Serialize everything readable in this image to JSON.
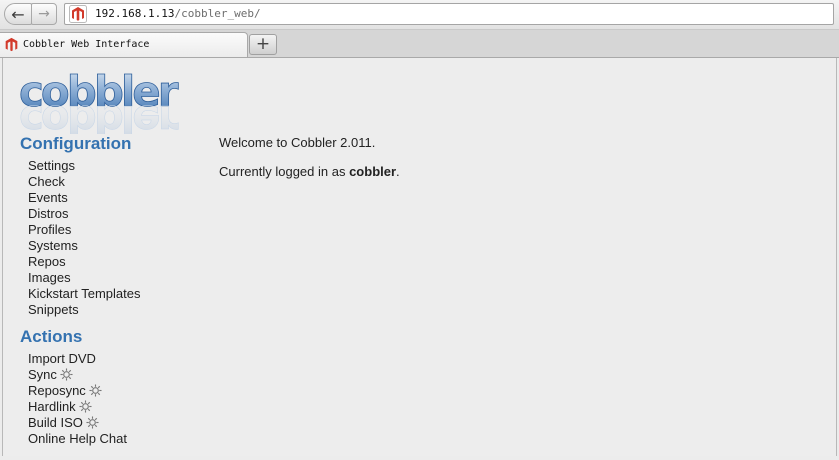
{
  "browser": {
    "url_host": "192.168.1.13",
    "url_path": "/cobbler_web/",
    "tab_title": "Cobbler Web Interface",
    "new_tab_symbol": "+",
    "back_symbol": "←",
    "forward_symbol": "→",
    "favicon_color": "#d23a2b"
  },
  "logo": {
    "text": "cobbler",
    "color": "#4c7fb8"
  },
  "sidebar": {
    "configuration_title": "Configuration",
    "configuration_items": [
      "Settings",
      "Check",
      "Events",
      "Distros",
      "Profiles",
      "Systems",
      "Repos",
      "Images",
      "Kickstart Templates",
      "Snippets"
    ],
    "actions_title": "Actions",
    "actions_items": [
      {
        "label": "Import DVD",
        "icon": ""
      },
      {
        "label": "Sync",
        "icon": "gear-icon"
      },
      {
        "label": "Reposync",
        "icon": "gear-icon"
      },
      {
        "label": "Hardlink",
        "icon": "gear-icon"
      },
      {
        "label": "Build ISO",
        "icon": "gear-icon"
      },
      {
        "label": "Online Help Chat",
        "icon": ""
      }
    ]
  },
  "main": {
    "welcome": "Welcome to Cobbler 2.011.",
    "login_prefix": "Currently logged in as ",
    "username": "cobbler",
    "login_suffix": "."
  },
  "colors": {
    "section_title": "#3472b0",
    "page_bg": "#ededed"
  }
}
